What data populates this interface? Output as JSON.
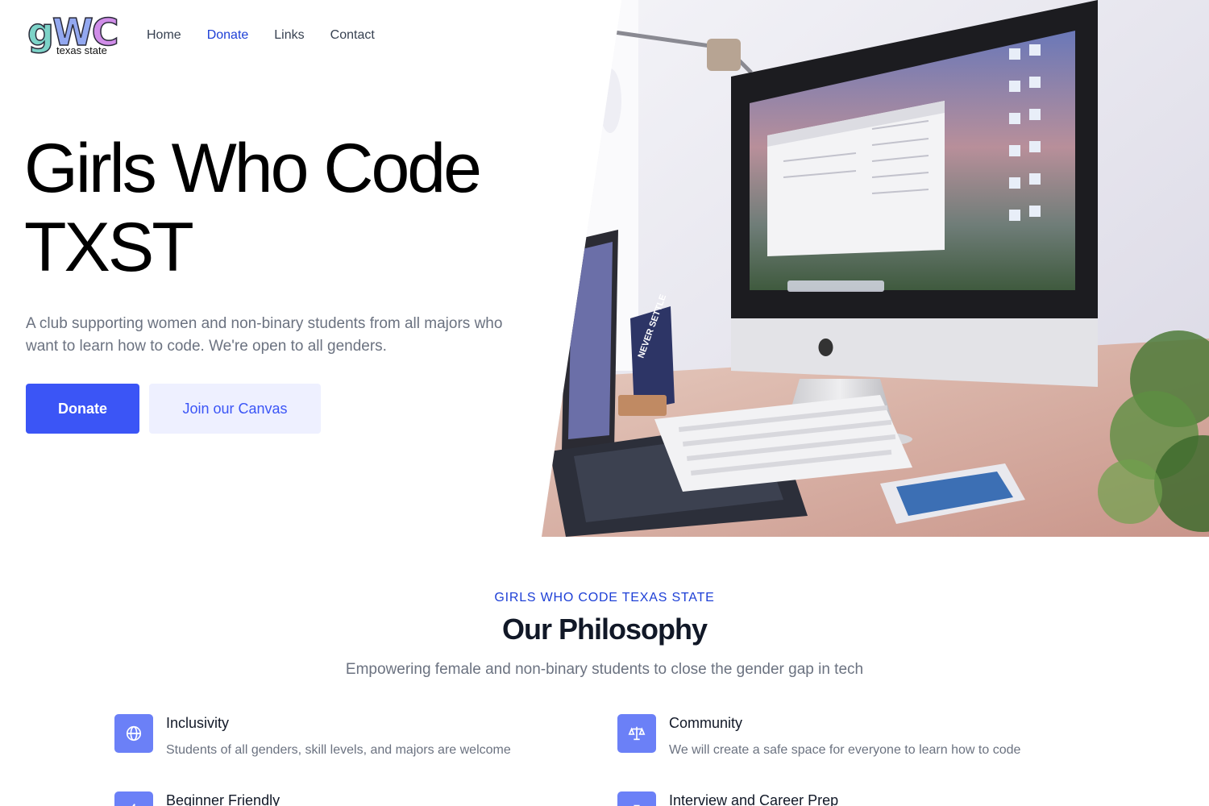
{
  "nav": {
    "logo_main": "gWC",
    "logo_sub": "texas state",
    "links": [
      {
        "label": "Home",
        "active": false
      },
      {
        "label": "Donate",
        "active": true
      },
      {
        "label": "Links",
        "active": false
      },
      {
        "label": "Contact",
        "active": false
      }
    ]
  },
  "hero": {
    "title_line1": "Girls Who Code",
    "title_line2": "TXST",
    "subtitle": "A club supporting women and non-binary students from all majors who want to learn how to code. We're open to all genders.",
    "primary_button": "Donate",
    "secondary_button": "Join our Canvas",
    "image_poster_text": "NEVER SETTLE"
  },
  "philosophy": {
    "eyebrow": "GIRLS WHO CODE TEXAS STATE",
    "title": "Our Philosophy",
    "subtitle": "Empowering female and non-binary students to close the gender gap in tech",
    "features": [
      {
        "title": "Inclusivity",
        "description": "Students of all genders, skill levels, and majors are welcome",
        "icon": "globe-icon"
      },
      {
        "title": "Community",
        "description": "We will create a safe space for everyone to learn how to code",
        "icon": "scale-icon"
      },
      {
        "title": "Beginner Friendly",
        "description": "",
        "icon": "lightning-icon"
      },
      {
        "title": "Interview and Career Prep",
        "description": "",
        "icon": "briefcase-icon"
      }
    ]
  },
  "colors": {
    "accent": "#3b55f6",
    "accent_light": "#eef0ff",
    "icon_bg": "#6b80f7",
    "eyebrow": "#1d3fd6"
  }
}
